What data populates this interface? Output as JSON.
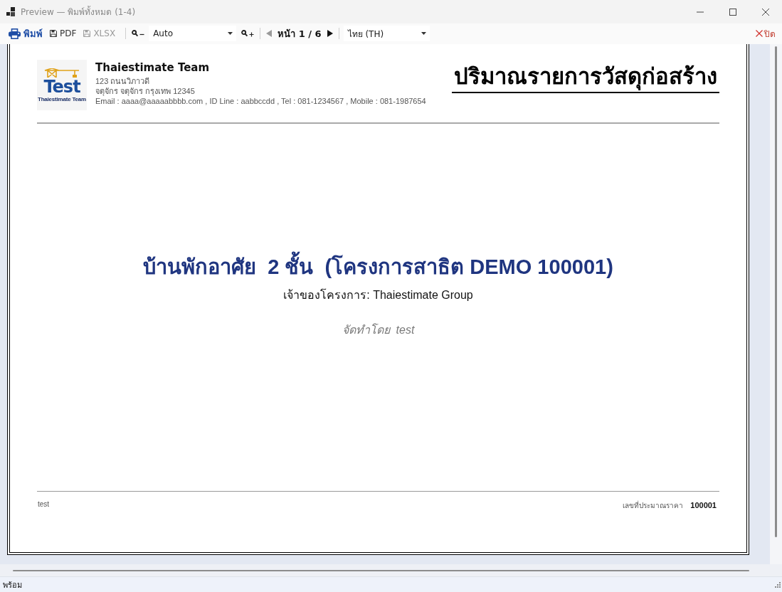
{
  "window": {
    "title": "Preview — พิมพ์ทั้งหมด (1-4)"
  },
  "toolbar": {
    "export_buttons": [
      {
        "kind": "print",
        "label": "พิมพ์",
        "disabled": false
      },
      {
        "kind": "pdf",
        "label": "PDF",
        "disabled": false
      },
      {
        "kind": "xlsx",
        "label": "XLSX",
        "disabled": true
      }
    ],
    "zoom": {
      "value": "Auto"
    },
    "previous_button": {
      "disabled": true
    },
    "page_indicator": "หน้า 1 / 6",
    "next_button": {
      "disabled": false
    },
    "language": {
      "value": "ไทย (TH)"
    },
    "close_button": {
      "label": "ปิด"
    }
  },
  "report": {
    "logo": {
      "text": "Test",
      "caption": "Thaiestimate Team"
    },
    "company": {
      "name": "Thaiestimate Team",
      "address_lines": [
        "123 ถนนวิภาวดี",
        "จตุจักร จตุจักร กรุงเทพ 12345",
        "Email : aaaa@aaaaabbbb.com , ID Line : aabbccdd , Tel : 081-1234567 , Mobile : 081-1987654"
      ]
    },
    "title": "ปริมาณรายการวัสดุก่อสร้าง",
    "project_title": "บ้านพักอาศัย  2 ชั้น  (โครงการสาธิต DEMO 100001)",
    "owner": "เจ้าของโครงการ: Thaiestimate Group",
    "prepared_by": "จัดทำโดย  test",
    "footer": {
      "left_text": "test",
      "estimate_label": "เลขที่ประมาณราคา",
      "estimate_number": "100001"
    }
  },
  "status_bar": {
    "text": "พร้อม"
  }
}
